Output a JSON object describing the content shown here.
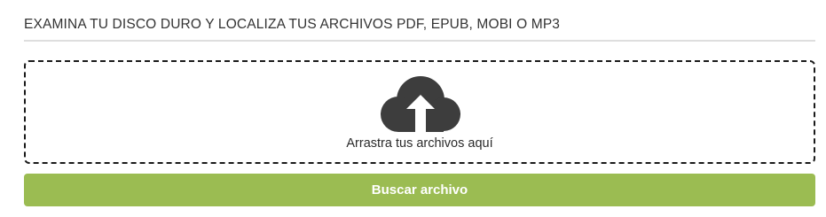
{
  "header": {
    "title": "EXAMINA TU DISCO DURO Y LOCALIZA TUS ARCHIVOS PDF, EPUB, MOBI O MP3"
  },
  "dropzone": {
    "icon": "cloud-upload-icon",
    "text": "Arrastra tus archivos aquí"
  },
  "actions": {
    "browse_label": "Buscar archivo"
  },
  "colors": {
    "accent": "#9bbc52",
    "icon": "#3d3d3d",
    "text": "#333333",
    "divider": "#dedede"
  }
}
